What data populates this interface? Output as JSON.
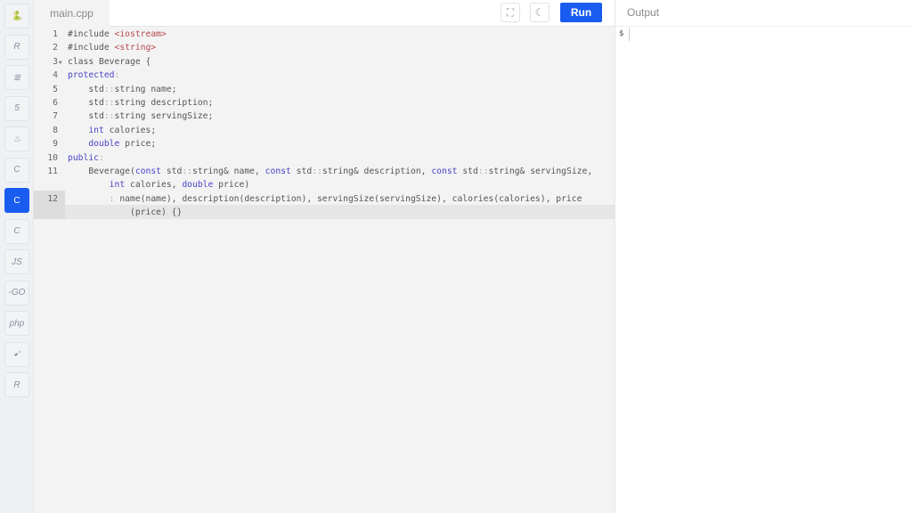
{
  "sidebar": {
    "items": [
      {
        "name": "python",
        "glyph": "🐍"
      },
      {
        "name": "r",
        "glyph": "R"
      },
      {
        "name": "database",
        "glyph": "≣"
      },
      {
        "name": "html5",
        "glyph": "5"
      },
      {
        "name": "java",
        "glyph": "♨"
      },
      {
        "name": "c",
        "glyph": "C"
      },
      {
        "name": "cpp",
        "glyph": "C"
      },
      {
        "name": "csharp",
        "glyph": "C"
      },
      {
        "name": "javascript",
        "glyph": "JS"
      },
      {
        "name": "go",
        "glyph": "-GO"
      },
      {
        "name": "php",
        "glyph": "php"
      },
      {
        "name": "swift",
        "glyph": "➹"
      },
      {
        "name": "rust",
        "glyph": "R"
      }
    ],
    "active": 6
  },
  "header": {
    "tab": "main.cpp",
    "run_label": "Run",
    "fullscreen_glyph": "⛶",
    "theme_glyph": "☾"
  },
  "editor": {
    "lines": [
      {
        "n": "1",
        "row": 0,
        "t": [
          [
            "#include ",
            ""
          ],
          [
            "<iostream>",
            "str"
          ]
        ]
      },
      {
        "n": "2",
        "row": 1,
        "t": [
          [
            "#include ",
            ""
          ],
          [
            "<string>",
            "str"
          ]
        ]
      },
      {
        "n": "3",
        "row": 2,
        "fold": true,
        "t": [
          [
            "class Beverage {",
            ""
          ]
        ]
      },
      {
        "n": "4",
        "row": 3,
        "t": [
          [
            "protected",
            "kw"
          ],
          [
            ":",
            "op"
          ]
        ]
      },
      {
        "n": "5",
        "row": 4,
        "t": [
          [
            "    std",
            ""
          ],
          [
            "::",
            "op"
          ],
          [
            "string name;",
            ""
          ]
        ]
      },
      {
        "n": "6",
        "row": 5,
        "t": [
          [
            "    std",
            ""
          ],
          [
            "::",
            "op"
          ],
          [
            "string description;",
            ""
          ]
        ]
      },
      {
        "n": "7",
        "row": 6,
        "t": [
          [
            "    std",
            ""
          ],
          [
            "::",
            "op"
          ],
          [
            "string servingSize;",
            ""
          ]
        ]
      },
      {
        "n": "8",
        "row": 7,
        "t": [
          [
            "    ",
            ""
          ],
          [
            "int",
            "kw"
          ],
          [
            " calories;",
            ""
          ]
        ]
      },
      {
        "n": "9",
        "row": 8,
        "t": [
          [
            "    ",
            ""
          ],
          [
            "double",
            "kw"
          ],
          [
            " price;",
            ""
          ]
        ]
      },
      {
        "n": "10",
        "row": 9,
        "t": [
          [
            "public",
            "kw"
          ],
          [
            ":",
            "op"
          ]
        ]
      },
      {
        "n": "11",
        "row": 10,
        "t": [
          [
            "    Beverage(",
            ""
          ],
          [
            "const",
            "kw"
          ],
          [
            " std",
            ""
          ],
          [
            "::",
            "op"
          ],
          [
            "string& name, ",
            ""
          ],
          [
            "const",
            "kw"
          ],
          [
            " std",
            ""
          ],
          [
            "::",
            "op"
          ],
          [
            "string& description, ",
            ""
          ],
          [
            "const",
            "kw"
          ],
          [
            " std",
            ""
          ],
          [
            "::",
            "op"
          ],
          [
            "string& servingSize,",
            ""
          ]
        ]
      },
      {
        "n": "",
        "row": 11,
        "t": [
          [
            "        ",
            ""
          ],
          [
            "int",
            "kw"
          ],
          [
            " calories, ",
            ""
          ],
          [
            "double",
            "kw"
          ],
          [
            " price)",
            ""
          ]
        ]
      },
      {
        "n": "12",
        "row": 12,
        "t": [
          [
            "        ",
            ""
          ],
          [
            ":",
            "op"
          ],
          [
            " name(name), description(description), servingSize(servingSize), calories(calories), price",
            ""
          ]
        ]
      },
      {
        "n": "",
        "row": 13,
        "t": [
          [
            "            (price) {}",
            ""
          ]
        ]
      }
    ]
  },
  "output": {
    "title": "Output",
    "prompt": "$"
  }
}
